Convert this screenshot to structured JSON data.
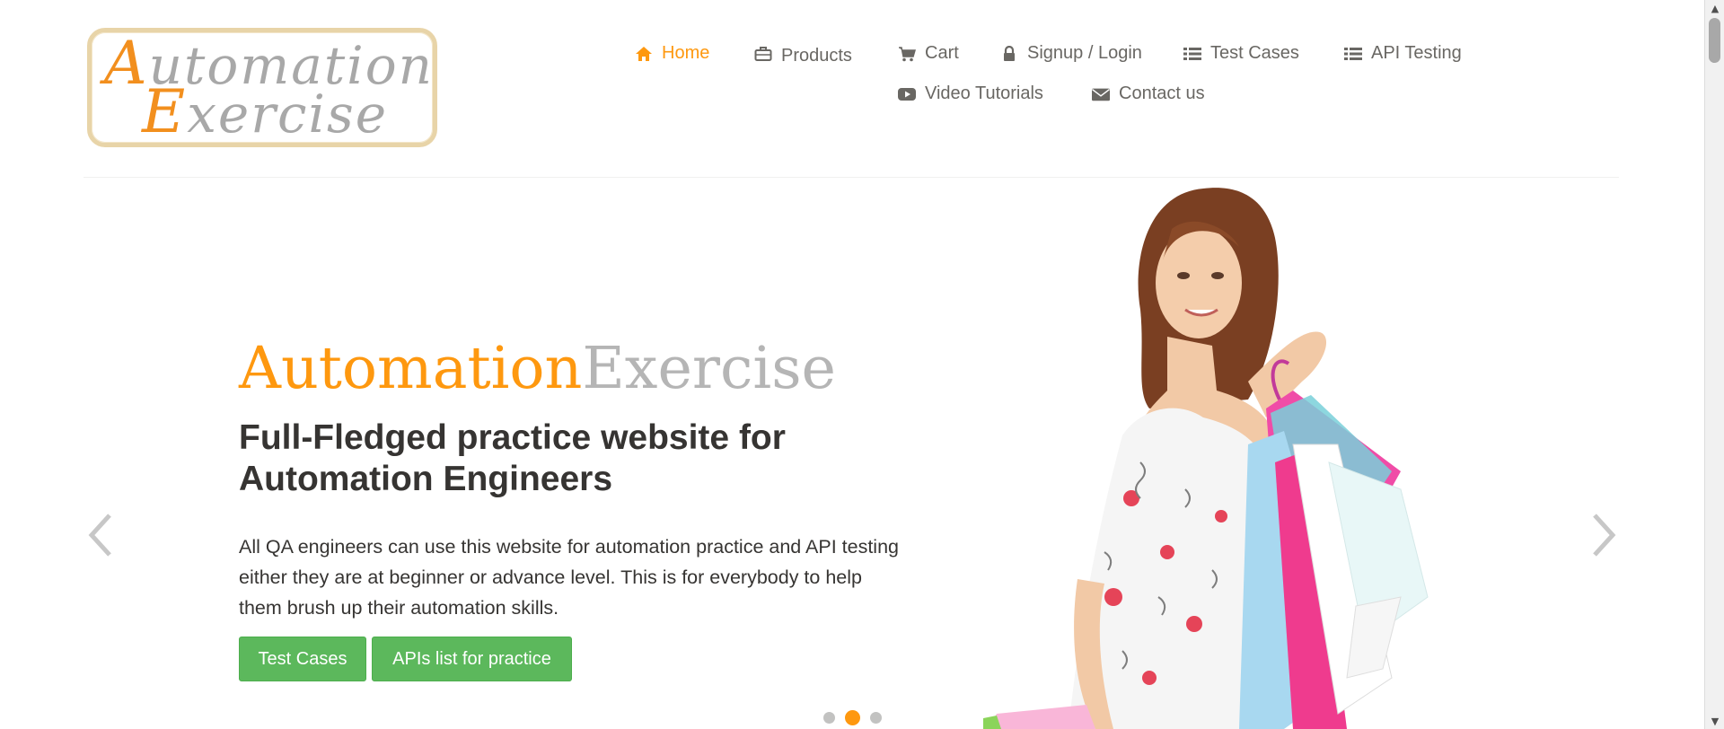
{
  "logo": {
    "line1_cap": "A",
    "line1_rest": "utomation",
    "line2_cap": "E",
    "line2_rest": "xercise"
  },
  "nav": {
    "home": "Home",
    "products": "Products",
    "cart": "Cart",
    "signup_login": "Signup / Login",
    "test_cases": "Test Cases",
    "api_testing": "API Testing",
    "video_tutorials": "Video Tutorials",
    "contact_us": "Contact us"
  },
  "hero": {
    "title_part1": "Automation",
    "title_part2": "Exercise",
    "subtitle": "Full-Fledged practice website for Automation Engineers",
    "description": "All QA engineers can use this website for automation practice and API testing either they are at beginner or advance level. This is for everybody to help them brush up their automation skills.",
    "button_test_cases": "Test Cases",
    "button_apis": "APIs list for practice"
  },
  "carousel": {
    "slide_count": 3,
    "active_index": 1
  },
  "icons": {
    "home": "home-icon",
    "products": "briefcase-icon",
    "cart": "cart-icon",
    "login": "lock-icon",
    "test_cases": "list-icon",
    "api_testing": "list-icon",
    "video": "youtube-play-icon",
    "contact": "envelope-icon"
  },
  "colors": {
    "accent": "#fe980f",
    "button": "#5cb85c",
    "text": "#696763",
    "heading": "#363432"
  }
}
